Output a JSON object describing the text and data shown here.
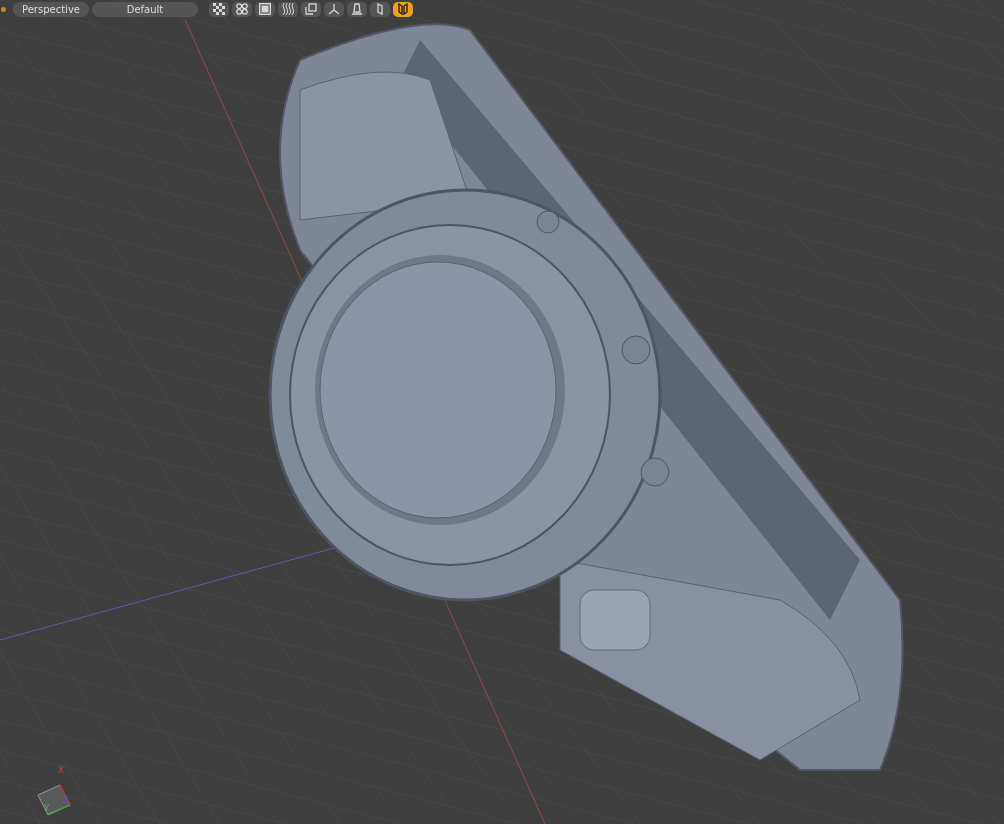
{
  "toolbar": {
    "camera": "Perspective",
    "display": "Default",
    "tools": [
      {
        "kind": "checker",
        "selected": false
      },
      {
        "kind": "quad",
        "selected": false
      },
      {
        "kind": "frame",
        "selected": false
      },
      {
        "kind": "waves",
        "selected": false
      },
      {
        "kind": "copy",
        "selected": false
      },
      {
        "kind": "axis",
        "selected": false
      },
      {
        "kind": "house",
        "selected": false
      },
      {
        "kind": "single",
        "selected": false
      },
      {
        "kind": "double",
        "selected": true
      }
    ]
  },
  "axis_gizmo": {
    "x_label": "X",
    "y_label": "Y",
    "z_label": "Z"
  }
}
